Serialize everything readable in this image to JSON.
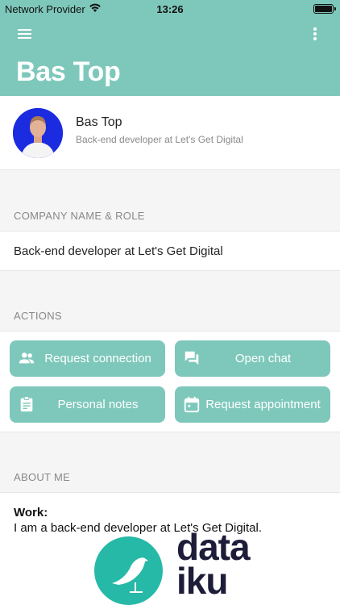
{
  "status_bar": {
    "carrier": "Network Provider",
    "time": "13:26"
  },
  "app_bar": {
    "title": "Bas Top",
    "menu_icon": "hamburger-menu-icon",
    "more_icon": "more-vertical-icon"
  },
  "profile": {
    "name": "Bas Top",
    "role": "Back-end developer at Let's Get Digital"
  },
  "company_section": {
    "header": "COMPANY NAME & ROLE",
    "value": "Back-end developer at Let's Get Digital"
  },
  "actions_section": {
    "header": "ACTIONS",
    "buttons": [
      {
        "label": "Request connection",
        "icon": "people-icon"
      },
      {
        "label": "Open chat",
        "icon": "chat-icon"
      },
      {
        "label": "Personal notes",
        "icon": "clipboard-icon"
      },
      {
        "label": "Request appointment",
        "icon": "calendar-icon"
      }
    ]
  },
  "about_section": {
    "header": "ABOUT ME",
    "work_label": "Work:",
    "work_text": "I am a back-end developer at Let's Get Digital."
  },
  "logo": {
    "line1": "data",
    "line2": "iku"
  },
  "colors": {
    "accent": "#7ec8bb",
    "logo_teal": "#27b9a7",
    "logo_text": "#1d1d3a",
    "avatar_bg": "#1a2be0"
  }
}
